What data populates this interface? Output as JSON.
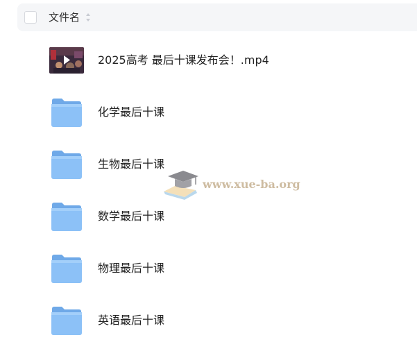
{
  "header": {
    "column_title": "文件名",
    "sort_icon": "sort-arrows-icon"
  },
  "files": [
    {
      "name": "2025高考 最后十课发布会！.mp4",
      "type": "video",
      "icon": "video-thumbnail-icon"
    },
    {
      "name": "化学最后十课",
      "type": "folder",
      "icon": "folder-icon"
    },
    {
      "name": "生物最后十课",
      "type": "folder",
      "icon": "folder-icon"
    },
    {
      "name": "数学最后十课",
      "type": "folder",
      "icon": "folder-icon"
    },
    {
      "name": "物理最后十课",
      "type": "folder",
      "icon": "folder-icon"
    },
    {
      "name": "英语最后十课",
      "type": "folder",
      "icon": "folder-icon"
    }
  ],
  "watermark": {
    "text": "www.xue-ba.org",
    "icon": "graduation-cap-icon"
  },
  "colors": {
    "header_bg": "#f5f6f8",
    "folder_blue": "#8cc1f7"
  }
}
